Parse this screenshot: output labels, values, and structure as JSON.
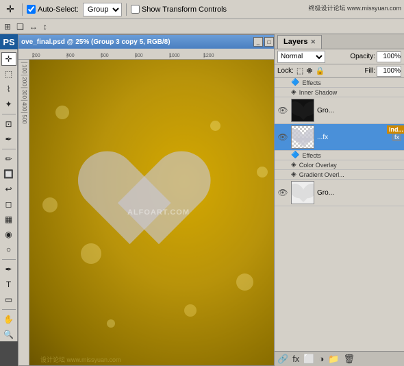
{
  "toolbar": {
    "auto_select_label": "Auto-Select:",
    "group_select": "Group",
    "show_transform": "Show Transform Controls",
    "watermark_top": "终极设计论坛 www.missyuan.com"
  },
  "canvas": {
    "title": "ove_final.psd @ 25% (Group 3 copy 5, RGB/8)",
    "watermark_center": "ALFOART.COM",
    "watermark_bottom": "设计论坛 www.missyuan.com",
    "ruler_marks": [
      "200",
      "400",
      "600",
      "800",
      "1000",
      "1200"
    ]
  },
  "layers": {
    "title": "Layers",
    "blend_mode": "Normal",
    "opacity_label": "Opacity:",
    "opacity_value": "100%",
    "lock_label": "Lock:",
    "fill_label": "Fill:",
    "fill_value": "100%",
    "items": [
      {
        "name": "Effects",
        "type": "sub-effect-header",
        "visible": true
      },
      {
        "name": "Inner Shadow",
        "type": "sub-effect",
        "visible": true
      },
      {
        "name": "Gro...",
        "type": "layer",
        "thumb": "dark-heart",
        "visible": true,
        "selected": false
      },
      {
        "name": "...fx",
        "type": "layer",
        "thumb": "transparent-content",
        "visible": true,
        "selected": true,
        "has_tag": true,
        "tag_text": "Ind...",
        "sub_effects": [
          {
            "name": "Effects"
          },
          {
            "name": "Color Overlay"
          },
          {
            "name": "Gradient Overl..."
          }
        ]
      },
      {
        "name": "Gro...",
        "type": "layer",
        "thumb": "white-heart",
        "visible": true,
        "selected": false
      }
    ],
    "bottom_icons": [
      "link-icon",
      "fx-icon",
      "mask-icon",
      "adjustment-icon",
      "folder-icon",
      "trash-icon"
    ]
  }
}
